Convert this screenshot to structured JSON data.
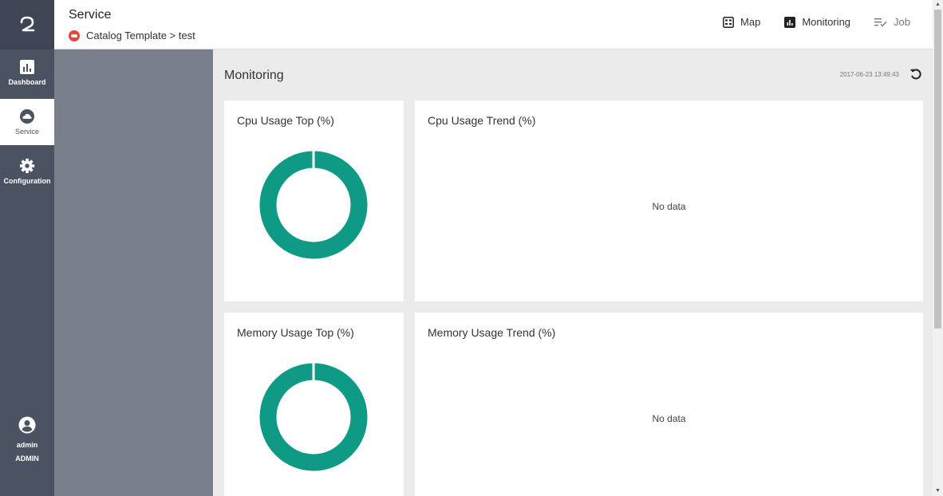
{
  "nav": {
    "items": [
      {
        "label": "Dashboard",
        "icon": "chart-bar-icon"
      },
      {
        "label": "Service",
        "icon": "cloud-icon"
      },
      {
        "label": "Configuration",
        "icon": "gear-icon"
      }
    ],
    "user": {
      "name": "admin",
      "role": "ADMIN"
    }
  },
  "header": {
    "title": "Service",
    "breadcrumb": "Catalog Template > test",
    "topnav": [
      {
        "label": "Map",
        "icon": "map-icon"
      },
      {
        "label": "Monitoring",
        "icon": "chart-bar-icon"
      },
      {
        "label": "Job",
        "icon": "list-check-icon"
      }
    ]
  },
  "main": {
    "title": "Monitoring",
    "timestamp": "2017-06-23 13:49:43"
  },
  "cards": {
    "cpu_top": {
      "title": "Cpu Usage Top (%)"
    },
    "cpu_trend": {
      "title": "Cpu Usage Trend (%)",
      "empty": "No data"
    },
    "mem_top": {
      "title": "Memory Usage Top (%)"
    },
    "mem_trend": {
      "title": "Memory Usage Trend (%)",
      "empty": "No data"
    }
  },
  "colors": {
    "accent": "#0f9a86",
    "nav": "#4b5261",
    "alert": "#e8453c"
  }
}
